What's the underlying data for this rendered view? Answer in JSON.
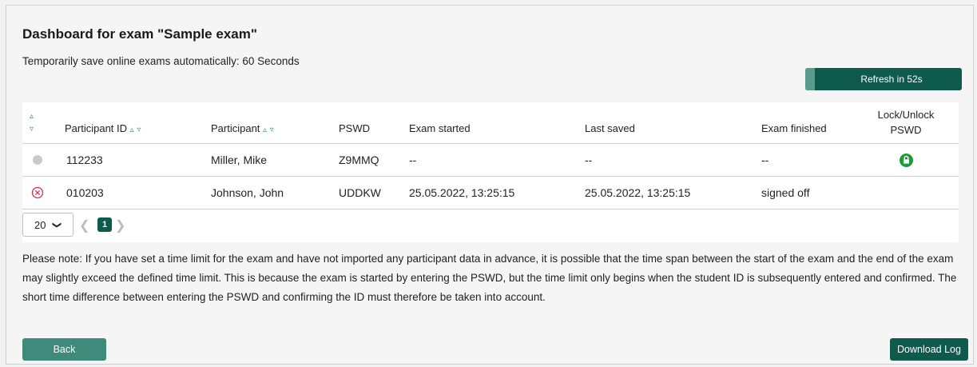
{
  "header": {
    "title": "Dashboard for exam \"Sample exam\"",
    "autosave_text": "Temporarily save online exams automatically: 60 Seconds"
  },
  "refresh": {
    "label": "Refresh in 52s",
    "progress_fraction": 0.06
  },
  "table": {
    "columns": {
      "participant_id": "Participant ID",
      "participant": "Participant",
      "pswd": "PSWD",
      "exam_started": "Exam started",
      "last_saved": "Last saved",
      "exam_finished": "Exam finished",
      "lock_line1": "Lock/Unlock",
      "lock_line2": "PSWD"
    },
    "sort_up": "▵",
    "sort_down": "▿",
    "rows": [
      {
        "status_icon": "gray-circle-icon",
        "participant_id": "112233",
        "participant": "Miller, Mike",
        "pswd": "Z9MMQ",
        "exam_started": "--",
        "last_saved": "--",
        "exam_finished": "--",
        "lock_icon": "unlocked-green-lock-icon"
      },
      {
        "status_icon": "red-x-circle-icon",
        "participant_id": "010203",
        "participant": "Johnson, John",
        "pswd": "UDDKW",
        "exam_started": "25.05.2022, 13:25:15",
        "last_saved": "25.05.2022, 13:25:15",
        "exam_finished": "signed off",
        "lock_icon": ""
      }
    ]
  },
  "pagination": {
    "per_page": "20",
    "current_page": "1"
  },
  "note": "Please note: If you have set a time limit for the exam and have not imported any participant data in advance, it is possible that the time span between the start of the exam and the end of the exam may slightly exceed the defined time limit. This is because the exam is started by entering the PSWD, but the time limit only begins when the student ID is subsequently entered and confirmed. The short time difference between entering the PSWD and confirming the ID must therefore be taken into account.",
  "buttons": {
    "back": "Back",
    "download_log": "Download Log"
  },
  "colors": {
    "primary": "#0e5a4c",
    "secondary": "#3f8a7a",
    "lock_green": "#1e9a3a",
    "error_red": "#d9304f"
  }
}
